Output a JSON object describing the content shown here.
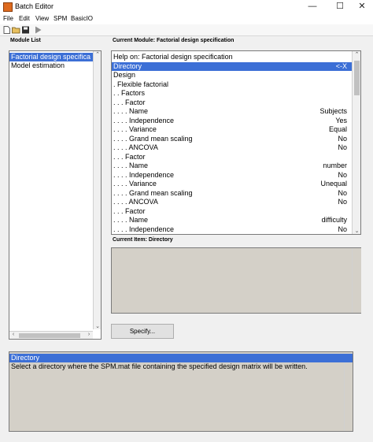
{
  "window": {
    "title": "Batch Editor",
    "minimize": "—",
    "maximize": "☐",
    "close": "✕"
  },
  "menu": [
    "File",
    "Edit",
    "View",
    "SPM",
    "BasicIO"
  ],
  "toolbar": {
    "icons": [
      "new-file-icon",
      "open-folder-icon",
      "save-icon",
      "run-icon"
    ]
  },
  "module_list": {
    "label": "Module List",
    "items": [
      "Factorial design specifica",
      "Model estimation"
    ],
    "selected_index": 0
  },
  "current_module": {
    "label": "Current Module: Factorial design specification",
    "rows": [
      {
        "label": "Help on: Factorial design specification",
        "value": ""
      },
      {
        "label": "Directory",
        "value": "<-X"
      },
      {
        "label": "Design",
        "value": ""
      },
      {
        "label": ". Flexible factorial",
        "value": ""
      },
      {
        "label": ". . Factors",
        "value": ""
      },
      {
        "label": ". . . Factor",
        "value": ""
      },
      {
        "label": ". . . . Name",
        "value": "Subjects"
      },
      {
        "label": ". . . . Independence",
        "value": "Yes"
      },
      {
        "label": ". . . . Variance",
        "value": "Equal"
      },
      {
        "label": ". . . . Grand mean scaling",
        "value": "No"
      },
      {
        "label": ". . . . ANCOVA",
        "value": "No"
      },
      {
        "label": ". . . Factor",
        "value": ""
      },
      {
        "label": ". . . . Name",
        "value": "number"
      },
      {
        "label": ". . . . Independence",
        "value": "No"
      },
      {
        "label": ". . . . Variance",
        "value": "Unequal"
      },
      {
        "label": ". . . . Grand mean scaling",
        "value": "No"
      },
      {
        "label": ". . . . ANCOVA",
        "value": "No"
      },
      {
        "label": ". . . Factor",
        "value": ""
      },
      {
        "label": ". . . . Name",
        "value": "difficulty"
      },
      {
        "label": ". . . . Independence",
        "value": "No"
      }
    ],
    "selected_index": 1
  },
  "current_item": {
    "label": "Current Item: Directory"
  },
  "specify_button": "Specify...",
  "help": {
    "title": "Directory",
    "text": "Select a directory where the SPM.mat file containing the specified design matrix will be written."
  },
  "colors": {
    "selection": "#3c6fd6",
    "panel_gray": "#d4d0c8",
    "app_icon": "#dd6a1f"
  }
}
